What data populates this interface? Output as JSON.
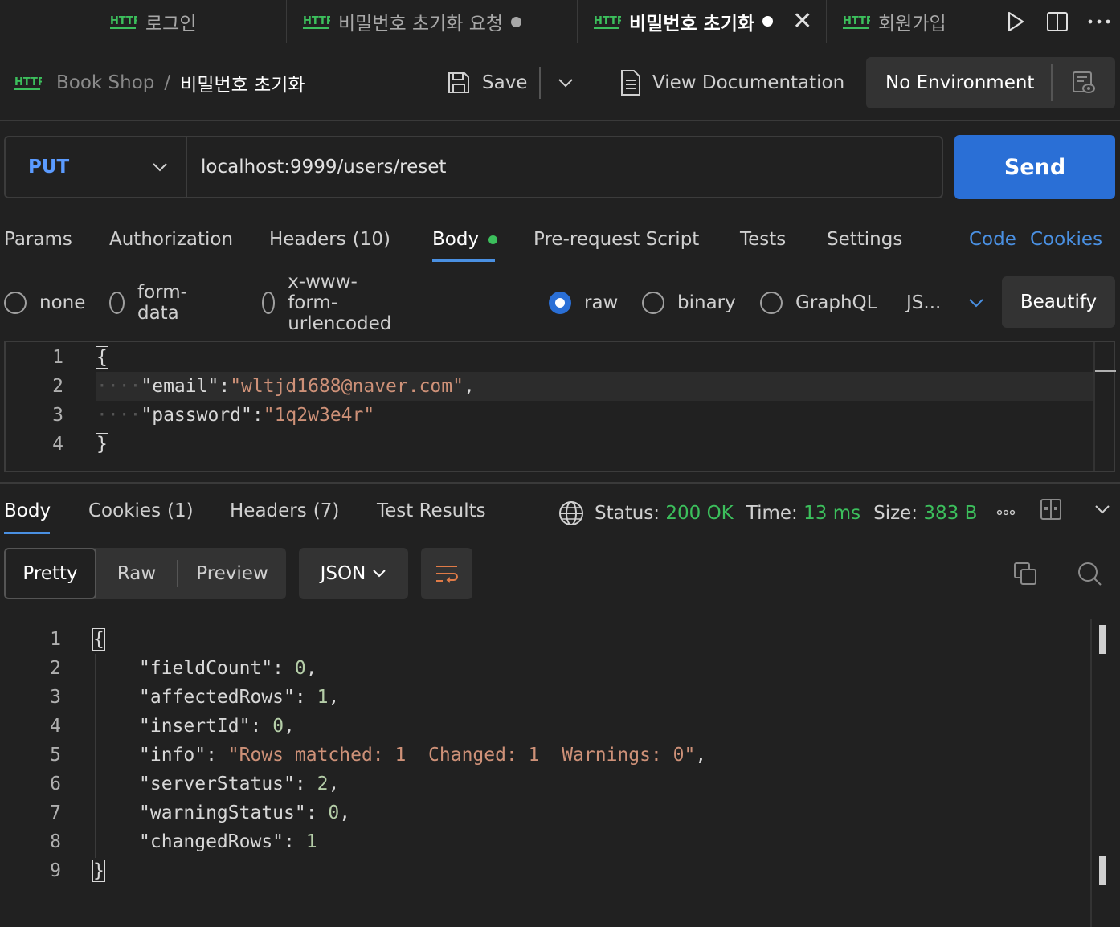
{
  "tabs": [
    {
      "label": "로그인",
      "modified": false,
      "active": false
    },
    {
      "label": "비밀번호 초기화 요청",
      "modified": true,
      "active": false
    },
    {
      "label": "비밀번호 초기화",
      "modified": true,
      "active": true
    },
    {
      "label": "회원가입",
      "modified": false,
      "active": false
    }
  ],
  "http_badge": "HTTP",
  "header": {
    "collection": "Book Shop",
    "separator": "/",
    "request_name": "비밀번호 초기화",
    "save_label": "Save",
    "view_docs_label": "View Documentation",
    "environment": "No Environment"
  },
  "request": {
    "method": "PUT",
    "url": "localhost:9999/users/reset",
    "send_label": "Send"
  },
  "request_tabs": {
    "params": "Params",
    "authorization": "Authorization",
    "headers": "Headers",
    "headers_count": "(10)",
    "body": "Body",
    "prerequest": "Pre-request Script",
    "tests": "Tests",
    "settings": "Settings",
    "code": "Code",
    "cookies": "Cookies"
  },
  "body_types": {
    "none": "none",
    "form_data": "form-data",
    "urlencoded": "x-www-form-urlencoded",
    "raw": "raw",
    "binary": "binary",
    "graphql": "GraphQL",
    "selected": "raw",
    "language": "JS...",
    "beautify": "Beautify"
  },
  "request_body": {
    "line_numbers": [
      "1",
      "2",
      "3",
      "4"
    ],
    "open_brace": "{",
    "close_brace": "}",
    "email_key": "\"email\"",
    "email_value": "\"wltjd1688@naver.com\"",
    "password_key": "\"password\"",
    "password_value": "\"1q2w3e4r\""
  },
  "response_tabs": {
    "body": "Body",
    "cookies": "Cookies",
    "cookies_count": "(1)",
    "headers": "Headers",
    "headers_count": "(7)",
    "test_results": "Test Results"
  },
  "response_meta": {
    "status_label": "Status:",
    "status_value": "200 OK",
    "time_label": "Time:",
    "time_value": "13 ms",
    "size_label": "Size:",
    "size_value": "383 B"
  },
  "response_view": {
    "pretty": "Pretty",
    "raw": "Raw",
    "preview": "Preview",
    "format": "JSON"
  },
  "response_body": {
    "line_numbers": [
      "1",
      "2",
      "3",
      "4",
      "5",
      "6",
      "7",
      "8",
      "9"
    ],
    "open_brace": "{",
    "close_brace": "}",
    "fields": [
      {
        "key": "\"fieldCount\"",
        "value": "0",
        "type": "number",
        "comma": ","
      },
      {
        "key": "\"affectedRows\"",
        "value": "1",
        "type": "number",
        "comma": ","
      },
      {
        "key": "\"insertId\"",
        "value": "0",
        "type": "number",
        "comma": ","
      },
      {
        "key": "\"info\"",
        "value": "\"Rows matched: 1  Changed: 1  Warnings: 0\"",
        "type": "string",
        "comma": ","
      },
      {
        "key": "\"serverStatus\"",
        "value": "2",
        "type": "number",
        "comma": ","
      },
      {
        "key": "\"warningStatus\"",
        "value": "0",
        "type": "number",
        "comma": ","
      },
      {
        "key": "\"changedRows\"",
        "value": "1",
        "type": "number",
        "comma": ""
      }
    ]
  },
  "colors": {
    "background": "#212121",
    "accent_blue": "#2a6fd6",
    "link_blue": "#4a90e2",
    "method_blue": "#5b9bff",
    "status_green": "#3cbf5c",
    "string_orange": "#ce9178",
    "number_green": "#b5cea8",
    "http_green": "#3cbf5c"
  }
}
